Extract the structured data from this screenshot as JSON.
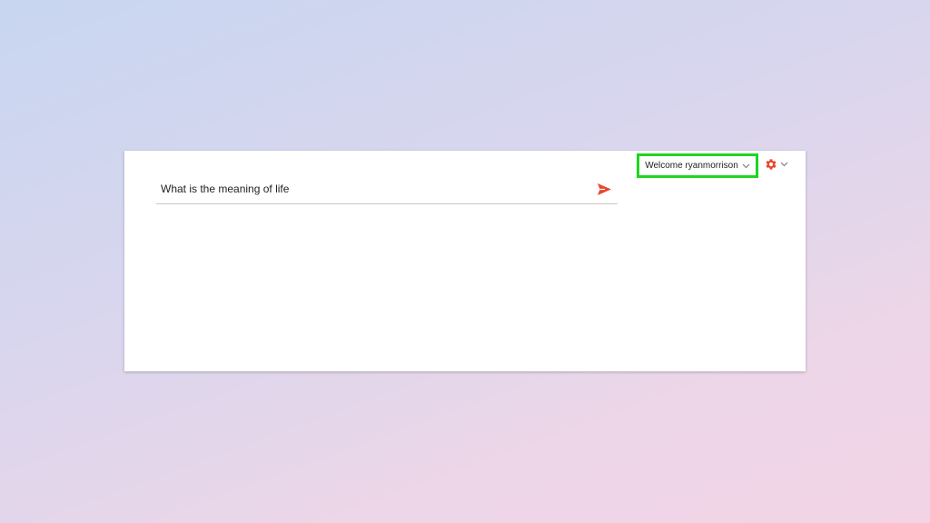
{
  "prompt": {
    "value": "What is the meaning of life",
    "send_icon": "send-icon"
  },
  "user_menu": {
    "label": "Welcome ryanmorrison",
    "icon": "chevron-down-icon"
  },
  "settings_menu": {
    "icon": "gear-icon",
    "chevron_icon": "chevron-down-icon"
  },
  "colors": {
    "accent": "#e8472e",
    "highlight_box": "#1fd51f"
  }
}
